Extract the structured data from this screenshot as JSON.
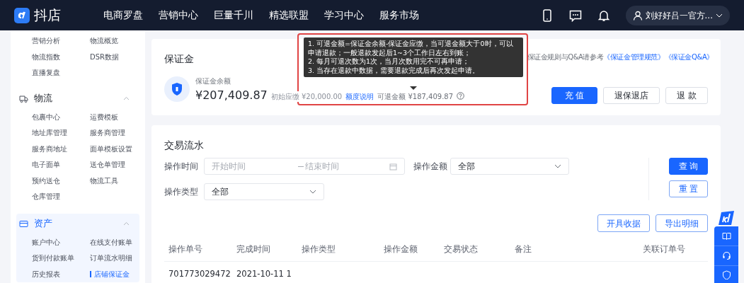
{
  "header": {
    "logo_text": "抖店",
    "nav": [
      {
        "label": "电商罗盘"
      },
      {
        "label": "营销中心"
      },
      {
        "label": "巨量千川"
      },
      {
        "label": "精选联盟"
      },
      {
        "label": "学习中心"
      },
      {
        "label": "服务市场"
      }
    ],
    "user": "刘好好吕一官方..."
  },
  "sidebar": {
    "sections": [
      {
        "expanded": true,
        "items": [
          {
            "label": "营销分析",
            "selected": false
          },
          {
            "label": "物流概览",
            "selected": false
          },
          {
            "label": "物流指数",
            "selected": false
          },
          {
            "label": "DSR数据",
            "selected": false
          },
          {
            "label": "直播复盘",
            "selected": false
          }
        ]
      },
      {
        "title": "物流",
        "expanded": true,
        "items": [
          {
            "label": "包裹中心",
            "selected": false
          },
          {
            "label": "运费模板",
            "selected": false
          },
          {
            "label": "地址库管理",
            "selected": false
          },
          {
            "label": "服务商管理",
            "selected": false
          },
          {
            "label": "服务商地址",
            "selected": false
          },
          {
            "label": "面单模板设置",
            "selected": false
          },
          {
            "label": "电子面单",
            "selected": false
          },
          {
            "label": "送仓单管理",
            "selected": false
          },
          {
            "label": "预约送仓",
            "selected": false
          },
          {
            "label": "物流工具",
            "selected": false
          },
          {
            "label": "仓库管理",
            "selected": false
          }
        ]
      },
      {
        "title": "资产",
        "expanded": true,
        "items": [
          {
            "label": "账户中心",
            "selected": false
          },
          {
            "label": "在线支付账单",
            "selected": false
          },
          {
            "label": "货到付款账单",
            "selected": false
          },
          {
            "label": "订单流水明细",
            "selected": false
          },
          {
            "label": "历史报表",
            "selected": false
          },
          {
            "label": "店铺保证金",
            "selected": true
          }
        ]
      }
    ]
  },
  "deposit": {
    "title": "保证金",
    "rules_text": "保证金规则与Q&A请参考",
    "links": [
      "《保证金管理规范》",
      "《保证金Q&A》"
    ],
    "balance_label": "保证金余额",
    "balance": "¥207,409.87",
    "initial": "初始应缴 ¥20,000.00",
    "quota_link": "额度说明",
    "refundable": "可退金额 ¥187,409.87",
    "buttons": [
      {
        "label": "充 值",
        "kind": "primary"
      },
      {
        "label": "退保退店",
        "kind": "plain"
      },
      {
        "label": "退 款",
        "kind": "plain"
      }
    ]
  },
  "tooltip": {
    "lines": [
      "1. 可退金额=保证金余额-保证金应缴，当可退金额大于0时，可以申请退款；一般退款发起后1~3个工作日左右到账；",
      "2. 每月可退次数为1次，当月次数用完不可再申请；",
      "3. 当存在退款中数据，需要退款完成后再次发起申请。"
    ]
  },
  "transactions": {
    "title": "交易流水",
    "filters": [
      {
        "label": "操作时间",
        "kind": "daterange",
        "start_placeholder": "开始时间",
        "end_placeholder": "结束时间"
      },
      {
        "label": "操作金额",
        "kind": "select",
        "value": "全部"
      },
      {
        "label": "操作类型",
        "kind": "select",
        "value": "全部"
      }
    ],
    "query_button": "查 询",
    "reset_button": "重 置",
    "actions": [
      "开具收据",
      "导出明细"
    ],
    "columns": [
      "操作单号",
      "完成时间",
      "操作类型",
      "操作金额",
      "交易状态",
      "备注",
      "关联订单号"
    ],
    "rows": [
      {
        "cells": [
          "701773029472",
          "2021-10-11 1",
          "",
          "",
          "",
          "",
          ""
        ]
      }
    ]
  }
}
